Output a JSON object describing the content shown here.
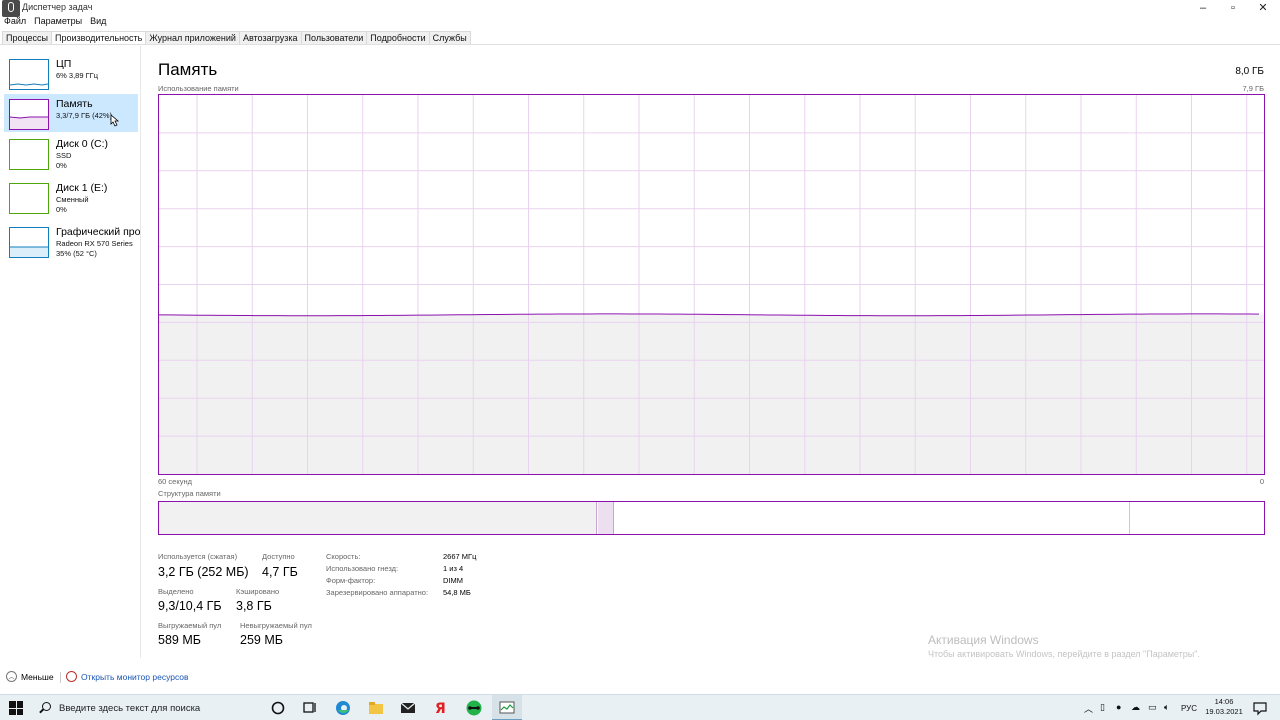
{
  "window": {
    "title": "Диспетчер задач"
  },
  "menu": [
    "Файл",
    "Параметры",
    "Вид"
  ],
  "tabs": [
    {
      "label": "Процессы",
      "active": false
    },
    {
      "label": "Производительность",
      "active": true
    },
    {
      "label": "Журнал приложений",
      "active": false
    },
    {
      "label": "Автозагрузка",
      "active": false
    },
    {
      "label": "Пользователи",
      "active": false
    },
    {
      "label": "Подробности",
      "active": false
    },
    {
      "label": "Службы",
      "active": false
    }
  ],
  "sidebar": {
    "items": [
      {
        "name": "ЦП",
        "sub1": "6% 3,89 ГГц",
        "sub2": "",
        "color": "#117dbb"
      },
      {
        "name": "Память",
        "sub1": "3,3/7,9 ГБ (42%)",
        "sub2": "",
        "color": "#8b12ae"
      },
      {
        "name": "Диск 0 (C:)",
        "sub1": "SSD",
        "sub2": "0%",
        "color": "#4da60c"
      },
      {
        "name": "Диск 1 (E:)",
        "sub1": "Сменный",
        "sub2": "0%",
        "color": "#4da60c"
      },
      {
        "name": "Графический про",
        "sub1": "Radeon RX 570 Series",
        "sub2": "35% (52 °C)",
        "color": "#117dbb"
      }
    ]
  },
  "main": {
    "title": "Память",
    "total": "8,0 ГБ",
    "usage_label": "Использование памяти",
    "max_label": "7,9 ГБ",
    "time_left": "60 секунд",
    "time_right": "0",
    "structure_label": "Структура памяти",
    "usage_fraction": 0.42
  },
  "stats": {
    "in_use_label": "Используется (сжатая)",
    "in_use_value": "3,2 ГБ (252 МБ)",
    "available_label": "Доступно",
    "available_value": "4,7 ГБ",
    "committed_label": "Выделено",
    "committed_value": "9,3/10,4 ГБ",
    "cached_label": "Кэшировано",
    "cached_value": "3,8 ГБ",
    "paged_label": "Выгружаемый пул",
    "paged_value": "589 МБ",
    "nonpaged_label": "Невыгружаемый пул",
    "nonpaged_value": "259 МБ",
    "speed_label": "Скорость:",
    "speed_value": "2667 МГц",
    "slots_label": "Использовано гнезд:",
    "slots_value": "1 из 4",
    "form_label": "Форм-фактор:",
    "form_value": "DIMM",
    "reserved_label": "Зарезервировано аппаратно:",
    "reserved_value": "54,8 МБ"
  },
  "watermark": {
    "title": "Активация Windows",
    "subtitle": "Чтобы активировать Windows, перейдите в раздел \"Параметры\"."
  },
  "footer": {
    "less": "Меньше",
    "monitor_link": "Открыть монитор ресурсов"
  },
  "taskbar": {
    "search_placeholder": "Введите здесь текст для поиска",
    "lang": "РУС",
    "time": "14:06",
    "date": "19.03.2021"
  },
  "colors": {
    "memory_accent": "#8b12ae",
    "grid": "#e9d2ef",
    "fill": "#f1f1f1"
  }
}
